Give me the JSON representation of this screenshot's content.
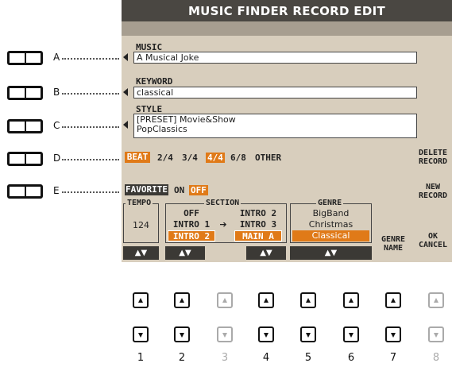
{
  "screen": {
    "title": "MUSIC FINDER RECORD EDIT",
    "music": {
      "label": "MUSIC",
      "value": "A Musical Joke"
    },
    "keyword": {
      "label": "KEYWORD",
      "value": "classical"
    },
    "style": {
      "label": "STYLE",
      "line1": "[PRESET]  Movie&Show",
      "line2": "PopClassics"
    },
    "beat": {
      "label": "BEAT",
      "options": [
        "2/4",
        "3/4",
        "4/4",
        "6/8",
        "OTHER"
      ],
      "selected": "4/4"
    },
    "favorite": {
      "label": "FAVORITE",
      "on": "ON",
      "off": "OFF",
      "selected": "OFF"
    },
    "tempo": {
      "label": "TEMPO",
      "value": "124"
    },
    "section": {
      "label": "SECTION",
      "items": [
        "OFF",
        "INTRO 2",
        "INTRO 1",
        "INTRO 3",
        "INTRO 2",
        "MAIN A"
      ],
      "arrow": "➔"
    },
    "genre": {
      "label": "GENRE",
      "items": [
        "BigBand",
        "Christmas",
        "Classical"
      ],
      "selected": "Classical"
    },
    "right_buttons": {
      "delete": [
        "DELETE",
        "RECORD"
      ],
      "new": [
        "NEW",
        "RECORD"
      ],
      "genre_name": [
        "GENRE",
        "NAME"
      ],
      "ok_cancel": [
        "OK",
        "CANCEL"
      ]
    },
    "updown_glyph": "▲▼"
  },
  "side_buttons": [
    "A",
    "B",
    "C",
    "D",
    "E"
  ],
  "bottom_buttons": {
    "numbers": [
      "1",
      "2",
      "3",
      "4",
      "5",
      "6",
      "7",
      "8"
    ],
    "disabled": [
      "3",
      "8"
    ]
  },
  "colors": {
    "accent": "#e07a18",
    "title_bar": "#4a4742",
    "screen_bg": "#d8cebd"
  }
}
